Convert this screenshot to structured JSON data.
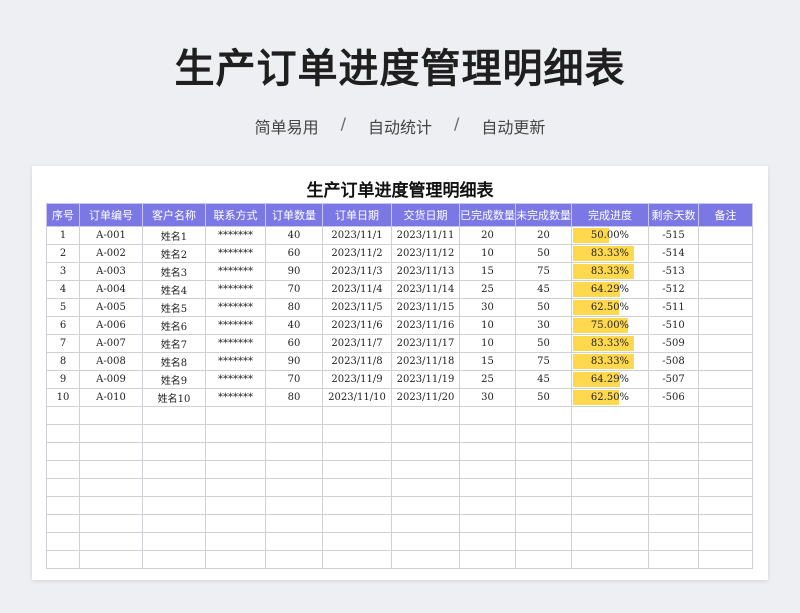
{
  "header": {
    "title": "生产订单进度管理明细表",
    "subtitle_items": [
      "简单易用",
      "自动统计",
      "自动更新"
    ],
    "separator": "/"
  },
  "sheet": {
    "title": "生产订单进度管理明细表",
    "columns": [
      "序号",
      "订单编号",
      "客户名称",
      "联系方式",
      "订单数量",
      "订单日期",
      "交货日期",
      "已完成数量",
      "未完成数量",
      "完成进度",
      "剩余天数",
      "备注"
    ],
    "rows": [
      {
        "no": "1",
        "order_id": "A-001",
        "customer": "姓名1",
        "contact": "*******",
        "qty": "40",
        "order_date": "2023/11/1",
        "delivery_date": "2023/11/11",
        "done": "20",
        "undone": "20",
        "progress_label": "50.00%",
        "progress": 0.5,
        "days_left": "-515",
        "note": ""
      },
      {
        "no": "2",
        "order_id": "A-002",
        "customer": "姓名2",
        "contact": "*******",
        "qty": "60",
        "order_date": "2023/11/2",
        "delivery_date": "2023/11/12",
        "done": "10",
        "undone": "50",
        "progress_label": "83.33%",
        "progress": 0.8333,
        "days_left": "-514",
        "note": ""
      },
      {
        "no": "3",
        "order_id": "A-003",
        "customer": "姓名3",
        "contact": "*******",
        "qty": "90",
        "order_date": "2023/11/3",
        "delivery_date": "2023/11/13",
        "done": "15",
        "undone": "75",
        "progress_label": "83.33%",
        "progress": 0.8333,
        "days_left": "-513",
        "note": ""
      },
      {
        "no": "4",
        "order_id": "A-004",
        "customer": "姓名4",
        "contact": "*******",
        "qty": "70",
        "order_date": "2023/11/4",
        "delivery_date": "2023/11/14",
        "done": "25",
        "undone": "45",
        "progress_label": "64.29%",
        "progress": 0.6429,
        "days_left": "-512",
        "note": ""
      },
      {
        "no": "5",
        "order_id": "A-005",
        "customer": "姓名5",
        "contact": "*******",
        "qty": "80",
        "order_date": "2023/11/5",
        "delivery_date": "2023/11/15",
        "done": "30",
        "undone": "50",
        "progress_label": "62.50%",
        "progress": 0.625,
        "days_left": "-511",
        "note": ""
      },
      {
        "no": "6",
        "order_id": "A-006",
        "customer": "姓名6",
        "contact": "*******",
        "qty": "40",
        "order_date": "2023/11/6",
        "delivery_date": "2023/11/16",
        "done": "10",
        "undone": "30",
        "progress_label": "75.00%",
        "progress": 0.75,
        "days_left": "-510",
        "note": ""
      },
      {
        "no": "7",
        "order_id": "A-007",
        "customer": "姓名7",
        "contact": "*******",
        "qty": "60",
        "order_date": "2023/11/7",
        "delivery_date": "2023/11/17",
        "done": "10",
        "undone": "50",
        "progress_label": "83.33%",
        "progress": 0.8333,
        "days_left": "-509",
        "note": ""
      },
      {
        "no": "8",
        "order_id": "A-008",
        "customer": "姓名8",
        "contact": "*******",
        "qty": "90",
        "order_date": "2023/11/8",
        "delivery_date": "2023/11/18",
        "done": "15",
        "undone": "75",
        "progress_label": "83.33%",
        "progress": 0.8333,
        "days_left": "-508",
        "note": ""
      },
      {
        "no": "9",
        "order_id": "A-009",
        "customer": "姓名9",
        "contact": "*******",
        "qty": "70",
        "order_date": "2023/11/9",
        "delivery_date": "2023/11/19",
        "done": "25",
        "undone": "45",
        "progress_label": "64.29%",
        "progress": 0.6429,
        "days_left": "-507",
        "note": ""
      },
      {
        "no": "10",
        "order_id": "A-010",
        "customer": "姓名10",
        "contact": "*******",
        "qty": "80",
        "order_date": "2023/11/10",
        "delivery_date": "2023/11/20",
        "done": "30",
        "undone": "50",
        "progress_label": "62.50%",
        "progress": 0.625,
        "days_left": "-506",
        "note": ""
      }
    ]
  },
  "colors": {
    "header_bg": "#7b78e6",
    "progress_bar": "#ffd84d"
  }
}
